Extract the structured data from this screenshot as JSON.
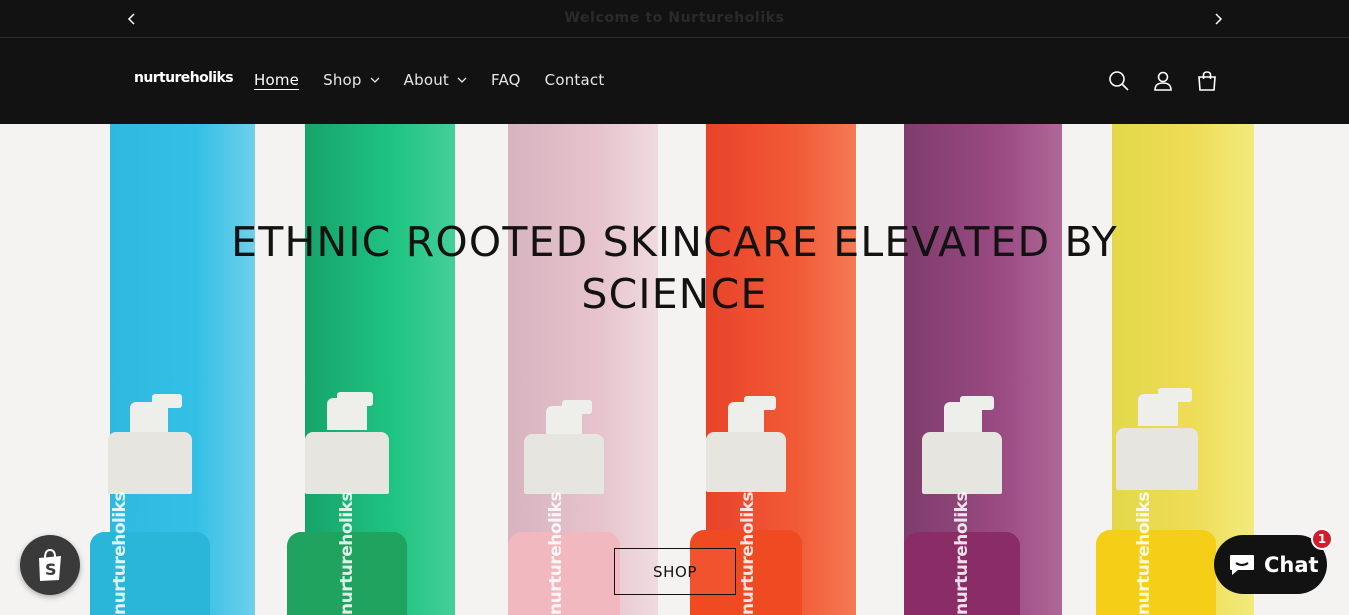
{
  "announcement": {
    "message": "Welcome to Nurtureholiks",
    "prev_icon": "chevron-left-icon",
    "next_icon": "chevron-right-icon"
  },
  "header": {
    "logo_text": "nurtureholiks",
    "nav": [
      {
        "label": "Home",
        "active": true
      },
      {
        "label": "Shop",
        "has_dropdown": true
      },
      {
        "label": "About",
        "has_dropdown": true
      },
      {
        "label": "FAQ"
      },
      {
        "label": "Contact"
      }
    ],
    "icons": [
      "search-icon",
      "account-icon",
      "cart-icon"
    ]
  },
  "hero": {
    "title_line1": "ETHNIC ROOTED SKINCARE ELEVATED BY",
    "title_line2": "SCIENCE",
    "cta_label": "SHOP",
    "bottle_brand": "nurtureholiks",
    "colors": {
      "blue": "#29b6d9",
      "green": "#1fa35f",
      "pink": "#f2b8c0",
      "orange": "#f04a22",
      "plum": "#8a2d66",
      "yellow": "#f5cf17"
    }
  },
  "floating": {
    "shopify_icon": "shopify-bag-icon",
    "chat_label": "Chat",
    "chat_badge_count": "1"
  },
  "theme": {
    "header_bg": "#121212",
    "text": "#121212",
    "chat_badge": "#d51a2c"
  }
}
